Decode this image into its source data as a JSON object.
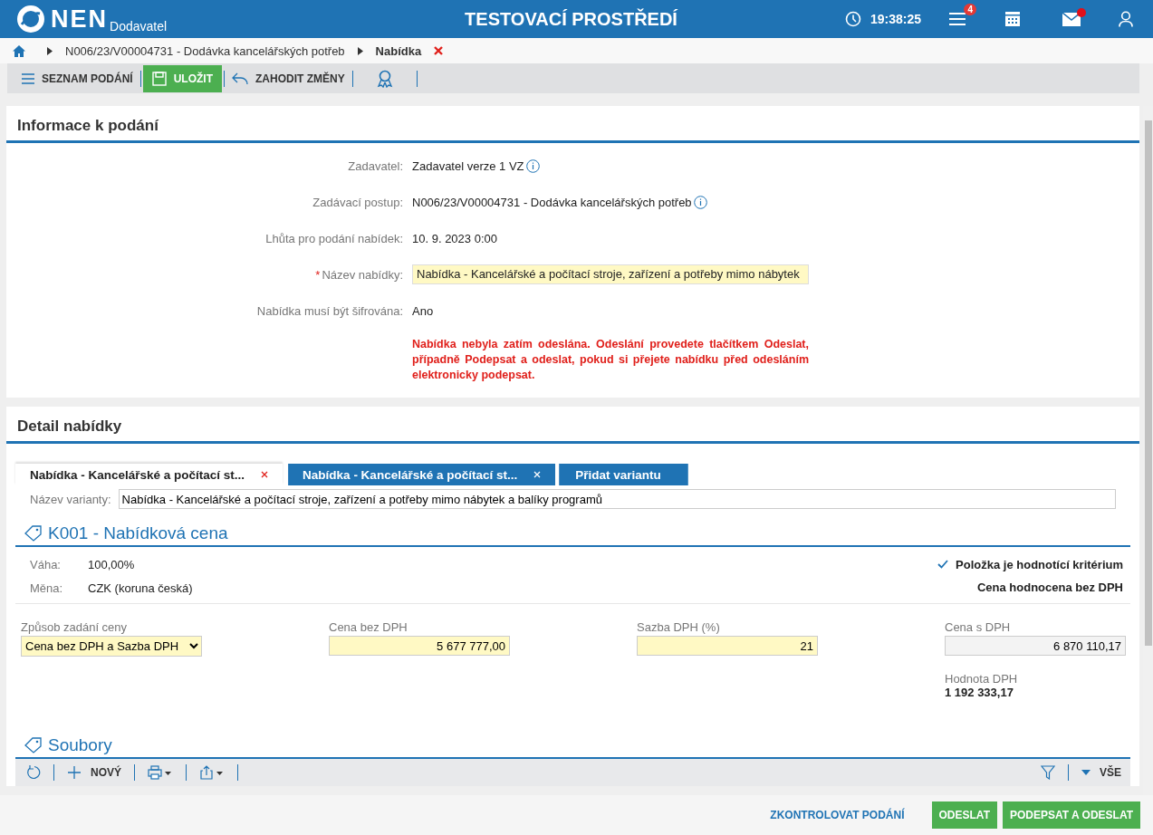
{
  "header": {
    "logo": "NEN",
    "subtitle": "Dodavatel",
    "title": "TESTOVACÍ PROSTŘEDÍ",
    "time": "19:38:25",
    "notification_count": "4",
    "mail_unread": true
  },
  "breadcrumb": {
    "items": [
      {
        "label": "N006/23/V00004731 - Dodávka kancelářských potřeb",
        "current": false
      },
      {
        "label": "Nabídka",
        "current": true
      }
    ]
  },
  "toolbar": [
    {
      "label": "SEZNAM PODÁNÍ",
      "kind": "list"
    },
    {
      "label": "ULOŽIT",
      "kind": "save"
    },
    {
      "label": "ZAHODIT ZMĚNY",
      "kind": "undo"
    },
    {
      "kind": "award"
    }
  ],
  "info": {
    "title": "Informace k podání",
    "fields": [
      {
        "label": "Zadavatel:",
        "value": "Zadavatel verze 1 VZ",
        "kind": "info"
      },
      {
        "label": "Zadávací postup:",
        "value": "N006/23/V00004731 - Dodávka kancelářských potřeb",
        "kind": "info"
      },
      {
        "label": "Lhůta pro podání nabídek:",
        "value": "10. 9. 2023 0:00",
        "kind": "text"
      },
      {
        "marker": "*",
        "label": "Název nabídky:",
        "value": "Nabídka - Kancelářské a počítací stroje, zařízení a potřeby mimo nábytek",
        "kind": "input"
      },
      {
        "label": "Nabídka musí být šifrována:",
        "value": "Ano",
        "kind": "text"
      }
    ],
    "warning": "Nabídka nebyla zatím odeslána. Odeslání provedete tlačítkem Odeslat, případně Podepsat a odeslat, pokud si přejete nabídku před odesláním elektronicky podepsat."
  },
  "detail": {
    "title": "Detail nabídky",
    "tabs": [
      {
        "label": "Nabídka - Kancelářské a počítací st...",
        "selected": true,
        "kind": "variant"
      },
      {
        "label": "Nabídka - Kancelářské a počítací st...",
        "selected": false,
        "kind": "variant"
      },
      {
        "label": "Přidat variantu",
        "selected": false,
        "kind": "add"
      }
    ],
    "variant_name": {
      "label": "Název varianty:",
      "value": "Nabídka - Kancelářské a počítací stroje, zařízení a potřeby mimo nábytek a balíky programů"
    },
    "criterion": {
      "title": "K001 - Nabídková cena",
      "rows": [
        {
          "label": "Váha:",
          "value": "100,00%"
        },
        {
          "label": "Měna:",
          "value": "CZK (koruna česká)"
        }
      ],
      "evaluated": {
        "label": "Položka je hodnotící kritérium",
        "checked": true
      },
      "note": "Cena hodnocena bez DPH",
      "price_fields": [
        {
          "label": "Způsob zadání ceny",
          "value": "Cena bez DPH a Sazba DPH",
          "kind": "select"
        },
        {
          "label": "Cena bez DPH",
          "value": "5 677 777,00",
          "kind": "input"
        },
        {
          "label": "Sazba DPH (%)",
          "value": "21",
          "kind": "input"
        },
        {
          "label": "Cena s DPH",
          "value": "6 870 110,17",
          "kind": "readonly"
        }
      ],
      "vat": {
        "label": "Hodnota DPH",
        "value": "1 192 333,17"
      }
    },
    "files": {
      "title": "Soubory",
      "new_label": "NOVÝ",
      "filter_label": "VŠE"
    }
  },
  "footer": [
    {
      "label": "ZKONTROLOVAT PODÁNÍ",
      "kind": "link"
    },
    {
      "label": "ODESLAT",
      "kind": "primary"
    },
    {
      "label": "PODEPSAT A ODESLAT",
      "kind": "primary"
    }
  ]
}
